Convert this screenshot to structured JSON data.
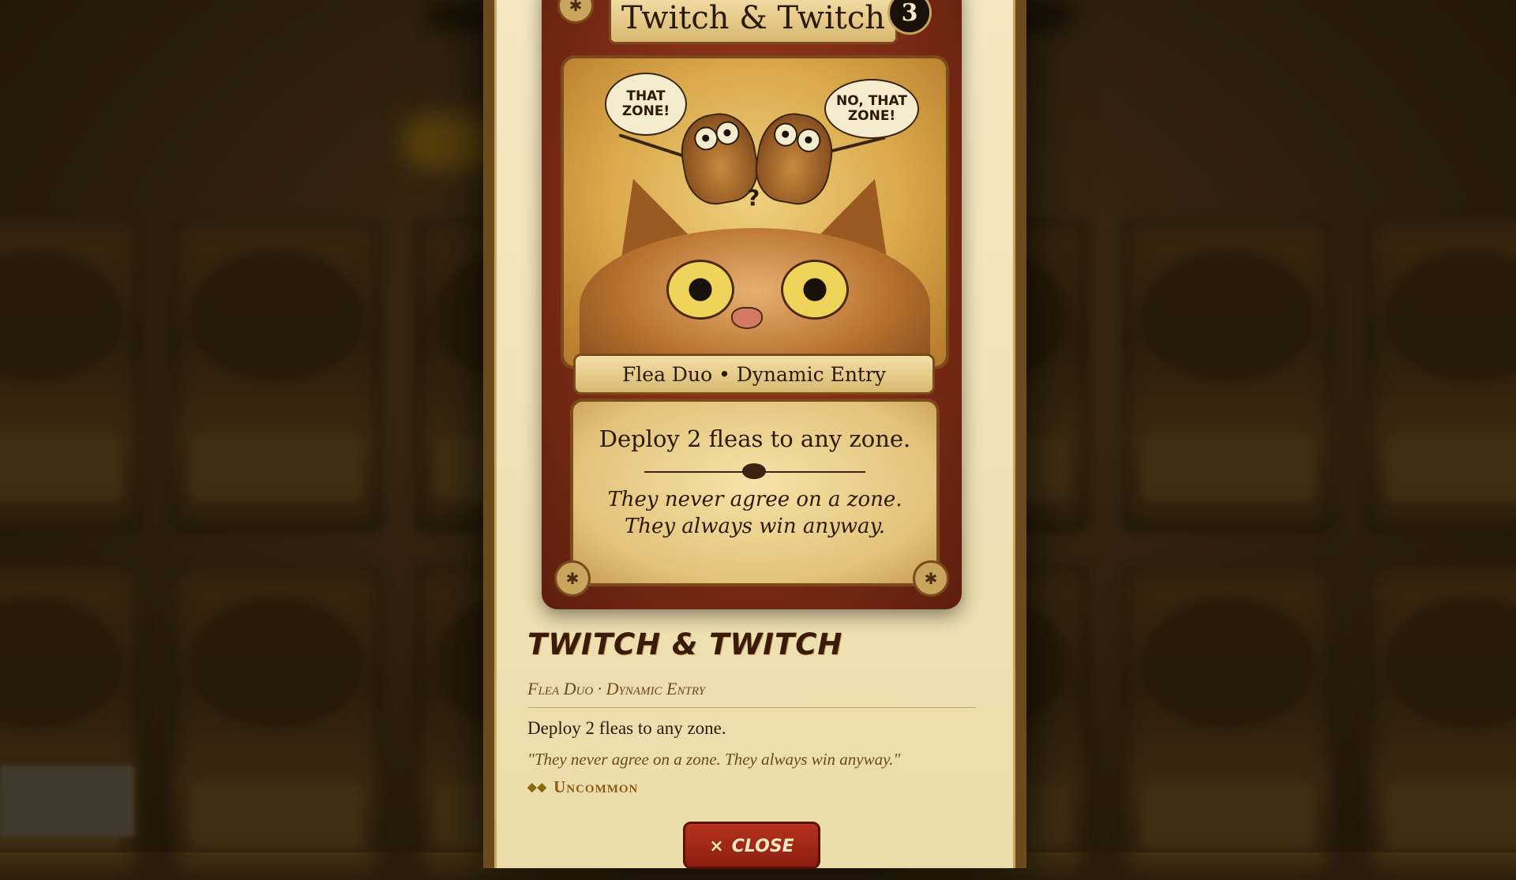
{
  "card": {
    "art_title": "Twitch & Twitch",
    "cost": "3",
    "bubble_left": "THAT ZONE!",
    "bubble_right": "NO, THAT ZONE!",
    "question_mark": "?",
    "art_subtitle": "Flea Duo • Dynamic Entry",
    "art_rules": "Deploy 2 fleas to any zone.",
    "art_flavor_line1": "They never agree on a zone.",
    "art_flavor_line2": "They always win anyway."
  },
  "details": {
    "title": "Twitch & Twitch",
    "type_line": "Flea Duo · Dynamic Entry",
    "description": "Deploy 2 fleas to any zone.",
    "flavor": "\"They never agree on a zone. They always win anyway.\"",
    "rarity_gems": "◆◆",
    "rarity": "Uncommon"
  },
  "actions": {
    "close_icon": "×",
    "close_label": "Close"
  },
  "colors": {
    "modal_bg": "#f2e4b8",
    "accent_brown": "#6b4a1c",
    "close_red": "#a8281a",
    "rarity_gold": "#8a5a10"
  }
}
